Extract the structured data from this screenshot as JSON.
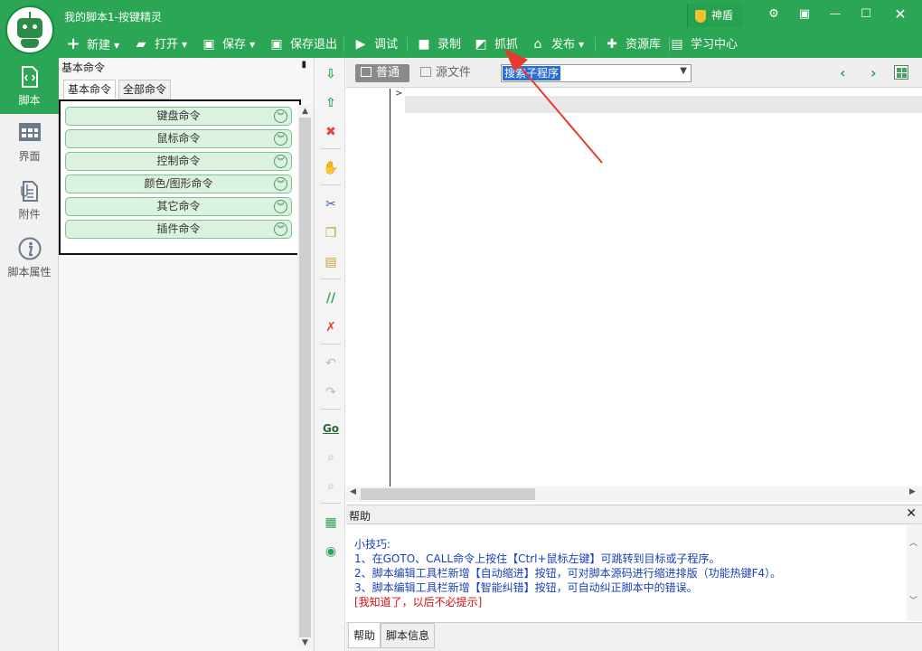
{
  "window": {
    "title": "我的脚本1-按键精灵",
    "shield_label": "神盾"
  },
  "toolbar": {
    "new": "新建",
    "open": "打开",
    "save": "保存",
    "save_exit": "保存退出",
    "debug": "调试",
    "record": "录制",
    "capture": "抓抓",
    "publish": "发布",
    "resources": "资源库",
    "learning": "学习中心"
  },
  "sidebar": {
    "items": [
      {
        "label": "脚本",
        "icon": "script-file-icon"
      },
      {
        "label": "界面",
        "icon": "interface-icon"
      },
      {
        "label": "附件",
        "icon": "attachment-icon"
      },
      {
        "label": "脚本属性",
        "icon": "info-icon"
      }
    ]
  },
  "command_panel": {
    "title": "基本命令",
    "tabs": [
      "基本命令",
      "全部命令"
    ],
    "items": [
      "键盘命令",
      "鼠标命令",
      "控制命令",
      "颜色/图形命令",
      "其它命令",
      "插件命令"
    ]
  },
  "editor": {
    "mode_normal": "普通",
    "mode_source": "源文件",
    "subroutine_search": "搜索子程序"
  },
  "help": {
    "title": "帮助",
    "lines": [
      "小技巧:",
      "1、在GOTO、CALL命令上按住【Ctrl+鼠标左键】可跳转到目标或子程序。",
      "2、脚本编辑工具栏新增【自动缩进】按钮，可对脚本源码进行缩进排版（功能热键F4）。",
      "3、脚本编辑工具栏新增【智能纠错】按钮，可自动纠正脚本中的错误。"
    ],
    "dismiss": "[我知道了，以后不必提示]",
    "tabs": [
      "帮助",
      "脚本信息"
    ]
  },
  "colors": {
    "brand_green": "#2aa654",
    "help_text": "#1a3fb8",
    "help_dismiss": "#d01010",
    "annotation_arrow": "#e8392f"
  }
}
